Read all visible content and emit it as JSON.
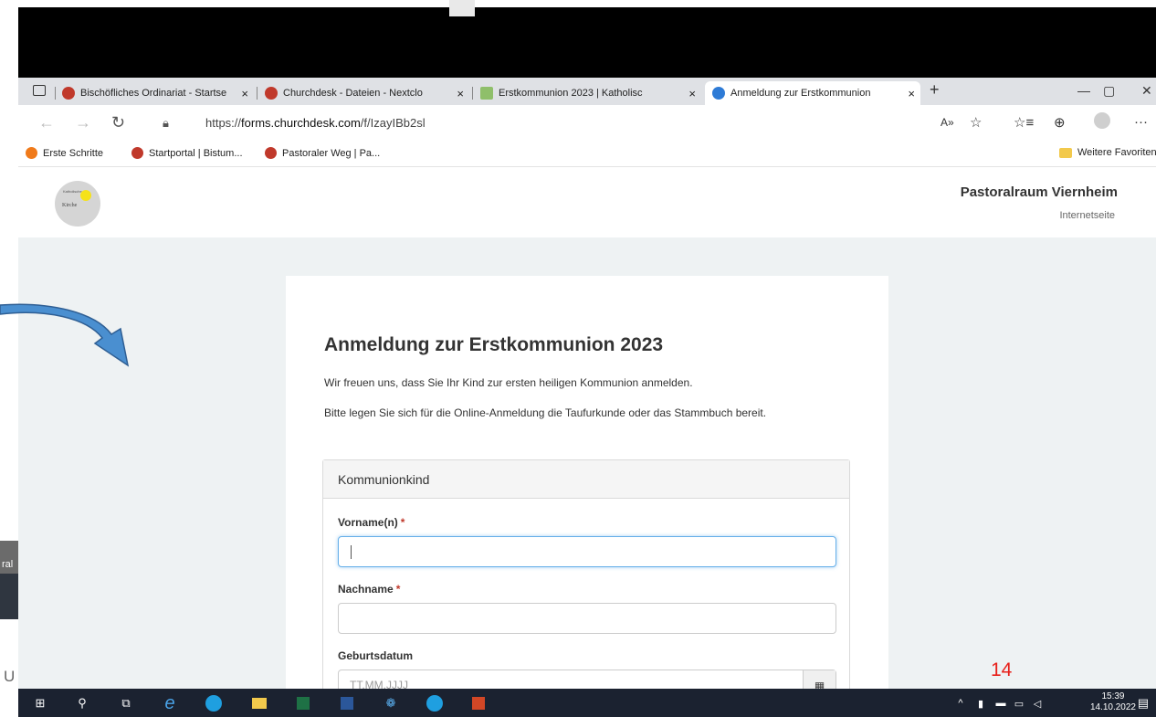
{
  "browser": {
    "tabs": [
      {
        "title": "Bischöfliches Ordinariat - Startse",
        "icon_color": "#c0392b",
        "active": false
      },
      {
        "title": "Churchdesk - Dateien - Nextclo",
        "icon_color": "#c0392b",
        "active": false
      },
      {
        "title": "Erstkommunion 2023 | Katholisc",
        "icon_color": "#8fbf6a",
        "active": false
      },
      {
        "title": "Anmeldung zur Erstkommunion",
        "icon_color": "#2e7bd6",
        "active": true
      }
    ],
    "tab_close_glyph": "×",
    "new_tab_glyph": "+",
    "url_prefix": "https://",
    "url_host": "forms.churchdesk.com",
    "url_path": "/f/IzayIBb2sl",
    "favorites": [
      {
        "label": "Erste Schritte",
        "icon_color": "#f07a1a"
      },
      {
        "label": "Startportal | Bistum...",
        "icon_color": "#c0392b"
      },
      {
        "label": "Pastoraler Weg | Pa...",
        "icon_color": "#c0392b"
      }
    ],
    "more_favorites": "Weitere Favoriten"
  },
  "site": {
    "logo_small_text": "Katholische",
    "logo_text": "Kirche",
    "title": "Pastoralraum Viernheim",
    "subtitle": "Internetseite"
  },
  "form": {
    "title": "Anmeldung zur Erstkommunion 2023",
    "intro_1": "Wir freuen uns, dass Sie Ihr Kind zur ersten heiligen Kommunion anmelden.",
    "intro_2": "Bitte legen Sie sich für die Online-Anmeldung die Taufurkunde oder das Stammbuch bereit.",
    "section_title": "Kommunionkind",
    "required_mark": "*",
    "fields": {
      "first_name": {
        "label": "Vorname(n)",
        "value": ""
      },
      "last_name": {
        "label": "Nachname",
        "value": ""
      },
      "birthdate": {
        "label": "Geburtsdatum",
        "placeholder": "TT.MM.JJJJ"
      }
    }
  },
  "overlay": {
    "slide_number": "14",
    "side_fragment_text": "ral",
    "side_letter": "U",
    "arrow_color": "#4a8fd0"
  },
  "taskbar": {
    "time": "15:39",
    "date": "14.10.2022"
  }
}
